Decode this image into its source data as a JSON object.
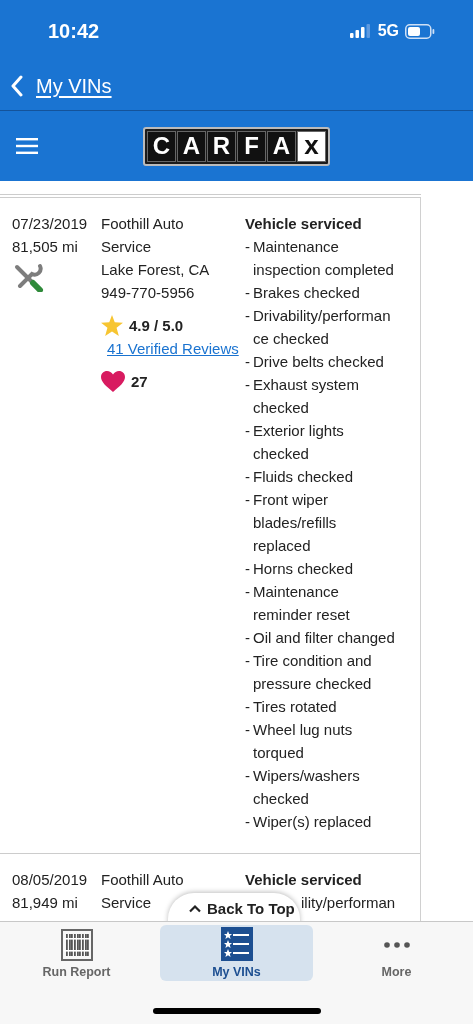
{
  "status_bar": {
    "time": "10:42",
    "network": "5G"
  },
  "nav": {
    "back_label": "My VINs"
  },
  "header": {
    "logo_letters": [
      "C",
      "A",
      "R",
      "F",
      "A",
      "x"
    ]
  },
  "records": [
    {
      "date": "07/23/2019",
      "mileage": "81,505 mi",
      "shop": {
        "name": "Foothill Auto Service",
        "location": "Lake Forest, CA",
        "phone": "949-770-5956",
        "rating": "4.9 / 5.0",
        "reviews": "41 Verified Reviews",
        "favorites": "27"
      },
      "title": "Vehicle serviced",
      "bullet": "-",
      "items": [
        "Maintenance inspection completed",
        "Brakes checked",
        "Drivability/performance checked",
        "Drive belts checked",
        "Exhaust system checked",
        "Exterior lights checked",
        "Fluids checked",
        "Front wiper blades/refills replaced",
        "Horns checked",
        "Maintenance reminder reset",
        "Oil and filter changed",
        "Tire condition and pressure checked",
        "Tires rotated",
        "Wheel lug nuts torqued",
        "Wipers/washers checked",
        "Wiper(s) replaced"
      ]
    },
    {
      "date": "08/05/2019",
      "mileage": "81,949 mi",
      "shop": {
        "name": "Foothill Auto Service"
      },
      "title": "Vehicle serviced",
      "cut_line": "ility/performan"
    }
  ],
  "back_to_top": "Back To Top",
  "tabs": [
    {
      "label": "Run Report",
      "selected": false
    },
    {
      "label": "My VINs",
      "selected": true
    },
    {
      "label": "More",
      "selected": false
    }
  ]
}
